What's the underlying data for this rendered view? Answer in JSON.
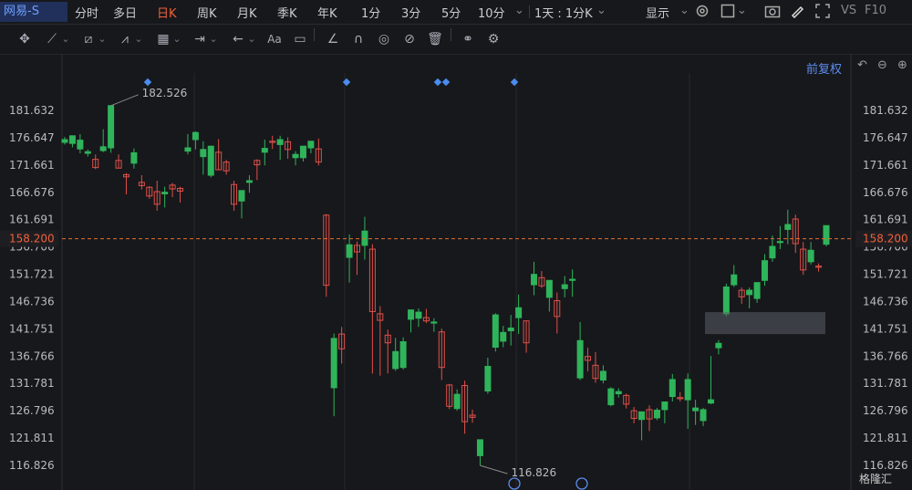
{
  "header": {
    "stock_name": "网易-S",
    "timeframes": [
      "分时",
      "多日",
      "日K",
      "周K",
      "月K",
      "季K",
      "年K",
      "1分",
      "3分",
      "5分",
      "10分"
    ],
    "active_timeframe": "日K",
    "period_selector": "1天 : 1分K",
    "display_label": "显示",
    "right_labels": [
      "VS",
      "F10"
    ]
  },
  "toolbar": {
    "icons": [
      "move-icon",
      "line-icon",
      "channel-icon",
      "wave-icon",
      "fib-icon",
      "measure-icon",
      "arrow-icon",
      "text-icon",
      "note-icon",
      "angle-icon",
      "magnet-icon",
      "eye-icon",
      "hide-icon",
      "trash-icon",
      "link-icon",
      "settings-icon"
    ],
    "text_tool": "Aa"
  },
  "chart_controls": {
    "adjust_label": "前复权"
  },
  "watermark": "格隆汇",
  "colors": {
    "up": "#2fb45b",
    "down": "#e0504a",
    "price_line": "#e07030",
    "bg": "#17181b"
  },
  "chart_data": {
    "type": "candlestick",
    "y_ticks": [
      "181.632",
      "176.647",
      "171.661",
      "166.676",
      "161.691",
      "156.706",
      "151.721",
      "146.736",
      "141.751",
      "136.766",
      "131.781",
      "126.796",
      "121.811",
      "116.826"
    ],
    "ylim": [
      116.826,
      181.632
    ],
    "current_price": "158.200",
    "high_label": "182.526",
    "low_label": "116.826",
    "candles": [
      {
        "o": 175.8,
        "h": 176.8,
        "l": 175.4,
        "c": 176.3
      },
      {
        "o": 175.6,
        "h": 176.9,
        "l": 174.9,
        "c": 177.0
      },
      {
        "o": 174.6,
        "h": 177.3,
        "l": 173.8,
        "c": 176.2
      },
      {
        "o": 173.8,
        "h": 174.5,
        "l": 173.2,
        "c": 174.1
      },
      {
        "o": 172.7,
        "h": 173.6,
        "l": 170.9,
        "c": 171.2
      },
      {
        "o": 174.3,
        "h": 178.2,
        "l": 174.0,
        "c": 175.0
      },
      {
        "o": 174.8,
        "h": 182.5,
        "l": 173.9,
        "c": 182.5
      },
      {
        "o": 172.5,
        "h": 173.6,
        "l": 171.2,
        "c": 171.1
      },
      {
        "o": 169.9,
        "h": 170.2,
        "l": 166.3,
        "c": 169.5
      },
      {
        "o": 172.0,
        "h": 174.7,
        "l": 171.0,
        "c": 173.9
      },
      {
        "o": 168.5,
        "h": 169.8,
        "l": 167.2,
        "c": 167.9
      },
      {
        "o": 167.6,
        "h": 167.8,
        "l": 165.5,
        "c": 166.0
      },
      {
        "o": 166.8,
        "h": 168.8,
        "l": 163.3,
        "c": 164.5
      },
      {
        "o": 166.4,
        "h": 167.7,
        "l": 163.9,
        "c": 166.7
      },
      {
        "o": 168.0,
        "h": 168.4,
        "l": 165.8,
        "c": 167.3
      },
      {
        "o": 167.4,
        "h": 167.7,
        "l": 164.8,
        "c": 166.9
      },
      {
        "o": 174.2,
        "h": 177.3,
        "l": 173.6,
        "c": 174.8
      },
      {
        "o": 176.3,
        "h": 177.8,
        "l": 174.5,
        "c": 177.6
      },
      {
        "o": 173.2,
        "h": 176.0,
        "l": 169.9,
        "c": 174.5
      },
      {
        "o": 169.8,
        "h": 175.2,
        "l": 169.4,
        "c": 175.1
      },
      {
        "o": 174.0,
        "h": 176.4,
        "l": 170.7,
        "c": 170.8
      },
      {
        "o": 172.2,
        "h": 172.6,
        "l": 169.9,
        "c": 170.6
      },
      {
        "o": 168.1,
        "h": 168.8,
        "l": 163.3,
        "c": 164.5
      },
      {
        "o": 165.1,
        "h": 166.2,
        "l": 161.9,
        "c": 167.0
      },
      {
        "o": 168.5,
        "h": 169.8,
        "l": 166.6,
        "c": 168.8
      },
      {
        "o": 172.5,
        "h": 172.7,
        "l": 168.9,
        "c": 171.7
      },
      {
        "o": 174.0,
        "h": 176.3,
        "l": 171.6,
        "c": 174.7
      },
      {
        "o": 176.0,
        "h": 177.0,
        "l": 174.6,
        "c": 175.8
      },
      {
        "o": 175.4,
        "h": 177.0,
        "l": 172.6,
        "c": 176.3
      },
      {
        "o": 175.9,
        "h": 176.7,
        "l": 172.8,
        "c": 174.5
      },
      {
        "o": 173.0,
        "h": 174.2,
        "l": 171.6,
        "c": 173.6
      },
      {
        "o": 173.0,
        "h": 173.1,
        "l": 172.3,
        "c": 175.1
      },
      {
        "o": 174.8,
        "h": 175.8,
        "l": 173.8,
        "c": 176.0
      },
      {
        "o": 174.6,
        "h": 176.5,
        "l": 171.6,
        "c": 172.2
      },
      {
        "o": 162.5,
        "h": 162.7,
        "l": 147.6,
        "c": 149.7
      },
      {
        "o": 131.0,
        "h": 140.9,
        "l": 125.8,
        "c": 140.0
      },
      {
        "o": 140.8,
        "h": 142.1,
        "l": 135.4,
        "c": 138.1
      },
      {
        "o": 154.8,
        "h": 159.0,
        "l": 150.2,
        "c": 157.1
      },
      {
        "o": 157.0,
        "h": 157.7,
        "l": 151.6,
        "c": 155.8
      },
      {
        "o": 157.0,
        "h": 162.2,
        "l": 154.4,
        "c": 159.6
      },
      {
        "o": 156.3,
        "h": 157.2,
        "l": 133.6,
        "c": 144.9
      },
      {
        "o": 144.5,
        "h": 145.9,
        "l": 133.2,
        "c": 143.3
      },
      {
        "o": 140.6,
        "h": 141.6,
        "l": 133.6,
        "c": 139.2
      },
      {
        "o": 134.5,
        "h": 140.1,
        "l": 134.1,
        "c": 137.6
      },
      {
        "o": 134.7,
        "h": 140.2,
        "l": 134.3,
        "c": 139.4
      },
      {
        "o": 143.5,
        "h": 145.3,
        "l": 141.1,
        "c": 145.2
      },
      {
        "o": 143.7,
        "h": 145.5,
        "l": 142.1,
        "c": 144.8
      },
      {
        "o": 143.8,
        "h": 145.4,
        "l": 142.8,
        "c": 143.2
      },
      {
        "o": 142.8,
        "h": 143.7,
        "l": 141.2,
        "c": 143.0
      },
      {
        "o": 141.2,
        "h": 141.8,
        "l": 132.4,
        "c": 134.7
      },
      {
        "o": 131.5,
        "h": 131.7,
        "l": 127.1,
        "c": 127.6
      },
      {
        "o": 127.2,
        "h": 130.7,
        "l": 126.8,
        "c": 129.8
      },
      {
        "o": 131.4,
        "h": 132.3,
        "l": 122.6,
        "c": 124.8
      },
      {
        "o": 126.0,
        "h": 127.0,
        "l": 124.6,
        "c": 125.6
      },
      {
        "o": 118.6,
        "h": 120.2,
        "l": 116.8,
        "c": 121.5
      },
      {
        "o": 130.4,
        "h": 136.5,
        "l": 129.9,
        "c": 134.9
      },
      {
        "o": 138.4,
        "h": 144.6,
        "l": 137.6,
        "c": 144.3
      },
      {
        "o": 139.5,
        "h": 142.3,
        "l": 138.4,
        "c": 141.1
      },
      {
        "o": 141.4,
        "h": 144.3,
        "l": 138.7,
        "c": 141.9
      },
      {
        "o": 143.8,
        "h": 148.0,
        "l": 140.8,
        "c": 145.6
      },
      {
        "o": 143.2,
        "h": 141.3,
        "l": 137.4,
        "c": 139.2
      },
      {
        "o": 149.8,
        "h": 154.0,
        "l": 147.9,
        "c": 151.7
      },
      {
        "o": 151.1,
        "h": 152.3,
        "l": 149.2,
        "c": 149.6
      },
      {
        "o": 147.5,
        "h": 150.1,
        "l": 144.9,
        "c": 150.6
      },
      {
        "o": 146.9,
        "h": 148.4,
        "l": 140.9,
        "c": 144.0
      },
      {
        "o": 149.1,
        "h": 151.4,
        "l": 147.5,
        "c": 149.8
      },
      {
        "o": 150.8,
        "h": 152.6,
        "l": 147.6,
        "c": 150.8
      },
      {
        "o": 132.8,
        "h": 143.0,
        "l": 132.4,
        "c": 139.6
      },
      {
        "o": 136.7,
        "h": 138.3,
        "l": 134.0,
        "c": 136.0
      },
      {
        "o": 135.1,
        "h": 137.5,
        "l": 131.9,
        "c": 132.7
      },
      {
        "o": 132.4,
        "h": 135.1,
        "l": 131.8,
        "c": 134.0
      },
      {
        "o": 127.9,
        "h": 131.1,
        "l": 127.6,
        "c": 130.8
      },
      {
        "o": 129.9,
        "h": 130.9,
        "l": 129.2,
        "c": 130.3
      },
      {
        "o": 129.6,
        "h": 129.9,
        "l": 127.2,
        "c": 128.0
      },
      {
        "o": 126.8,
        "h": 127.5,
        "l": 124.5,
        "c": 125.4
      },
      {
        "o": 125.2,
        "h": 126.4,
        "l": 121.4,
        "c": 126.6
      },
      {
        "o": 127.0,
        "h": 127.8,
        "l": 123.1,
        "c": 125.3
      },
      {
        "o": 125.5,
        "h": 127.3,
        "l": 125.1,
        "c": 126.9
      },
      {
        "o": 127.0,
        "h": 128.3,
        "l": 124.5,
        "c": 128.4
      },
      {
        "o": 129.4,
        "h": 133.5,
        "l": 128.5,
        "c": 132.5
      },
      {
        "o": 129.2,
        "h": 130.2,
        "l": 128.5,
        "c": 129.1
      },
      {
        "o": 128.8,
        "h": 133.6,
        "l": 123.5,
        "c": 132.5
      },
      {
        "o": 126.8,
        "h": 128.8,
        "l": 124.2,
        "c": 127.3
      },
      {
        "o": 125.0,
        "h": 127.3,
        "l": 124.0,
        "c": 127.0
      },
      {
        "o": 128.2,
        "h": 136.8,
        "l": 128.0,
        "c": 128.8
      },
      {
        "o": 138.3,
        "h": 139.7,
        "l": 137.1,
        "c": 139.1
      },
      {
        "o": 144.5,
        "h": 150.0,
        "l": 144.0,
        "c": 149.4
      },
      {
        "o": 149.8,
        "h": 153.4,
        "l": 149.4,
        "c": 151.6
      },
      {
        "o": 148.8,
        "h": 149.3,
        "l": 146.3,
        "c": 147.6
      },
      {
        "o": 148.0,
        "h": 149.3,
        "l": 145.5,
        "c": 148.8
      },
      {
        "o": 147.3,
        "h": 149.6,
        "l": 146.5,
        "c": 150.2
      },
      {
        "o": 150.6,
        "h": 155.4,
        "l": 149.6,
        "c": 154.2
      },
      {
        "o": 154.7,
        "h": 158.8,
        "l": 154.0,
        "c": 156.8
      },
      {
        "o": 157.5,
        "h": 160.5,
        "l": 156.3,
        "c": 157.7
      },
      {
        "o": 159.9,
        "h": 163.5,
        "l": 157.2,
        "c": 160.8
      },
      {
        "o": 161.8,
        "h": 162.6,
        "l": 155.6,
        "c": 157.3
      },
      {
        "o": 156.3,
        "h": 157.6,
        "l": 151.6,
        "c": 152.5
      },
      {
        "o": 154.0,
        "h": 157.6,
        "l": 153.5,
        "c": 156.1
      },
      {
        "o": 153.2,
        "h": 153.7,
        "l": 152.2,
        "c": 153.1
      },
      {
        "o": 157.2,
        "h": 159.7,
        "l": 156.8,
        "c": 160.6
      }
    ]
  }
}
